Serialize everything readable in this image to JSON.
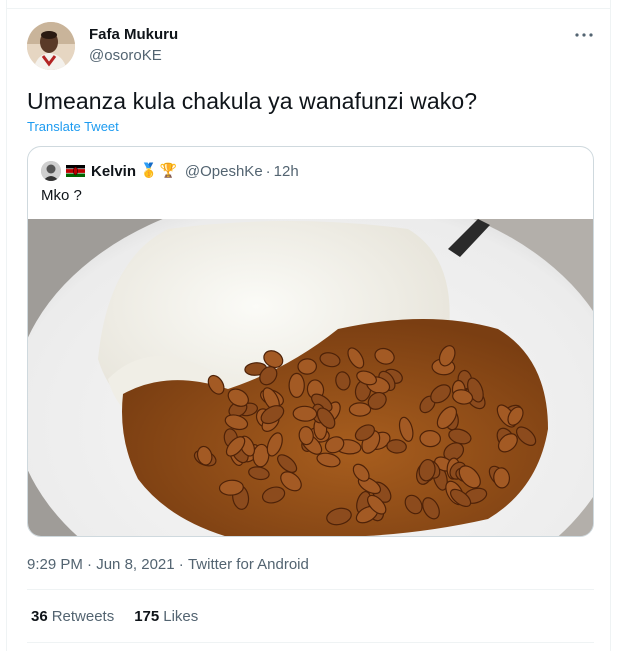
{
  "author": {
    "name": "Fafa Mukuru",
    "handle": "@osoroKE"
  },
  "tweet": {
    "text": "Umeanza kula chakula ya wanafunzi wako?",
    "translate_label": "Translate Tweet"
  },
  "quoted_tweet": {
    "name": "Kelvin",
    "badges": [
      "🥇",
      "🏆"
    ],
    "handle": "@OpeshKe",
    "separator": "·",
    "time": "12h",
    "text": "Mko ?",
    "flag_colors": [
      "#000000",
      "#ffffff",
      "#bb0000",
      "#006600"
    ],
    "media_description_icon": "photo-rice-and-beans"
  },
  "meta": {
    "time": "9:29 PM",
    "separator": "·",
    "date": "Jun 8, 2021",
    "source": "Twitter for Android"
  },
  "stats": {
    "retweets_count": "36",
    "retweets_label": "Retweets",
    "likes_count": "175",
    "likes_label": "Likes"
  },
  "colors": {
    "link": "#1d9bf0",
    "secondary_text": "#536471",
    "border": "#cfd9de"
  }
}
